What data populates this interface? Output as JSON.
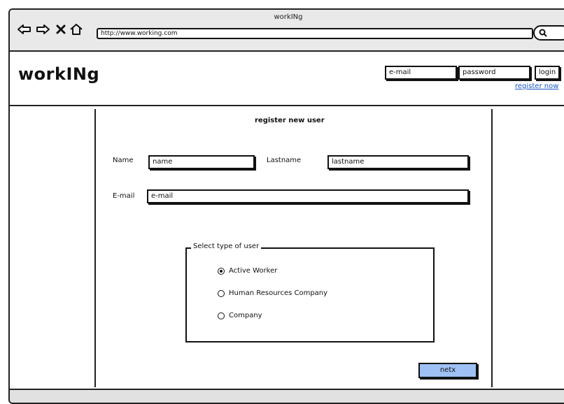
{
  "browser": {
    "title": "workINg",
    "url": "http://www.working.com",
    "icons": [
      "back-arrow-icon",
      "forward-arrow-icon",
      "close-icon",
      "home-icon",
      "search-icon"
    ]
  },
  "header": {
    "logo": "workINg",
    "email_placeholder": "e-mail",
    "password_placeholder": "password",
    "login_label": "login",
    "register_label": "register now"
  },
  "form": {
    "title": "register new user",
    "name_label": "Name",
    "name_value": "name",
    "lastname_label": "Lastname",
    "lastname_value": "lastname",
    "email_label": "E-mail",
    "email_value": "e-mail",
    "user_type": {
      "legend": "Select type of user",
      "options": [
        {
          "label": "Active Worker",
          "selected": true
        },
        {
          "label": "Human Resources Company",
          "selected": false
        },
        {
          "label": "Company",
          "selected": false
        }
      ]
    },
    "next_label": "netx"
  },
  "colors": {
    "accent_button": "#9ec0f4",
    "link": "#1a57c4",
    "chrome": "#e9e9e9"
  }
}
